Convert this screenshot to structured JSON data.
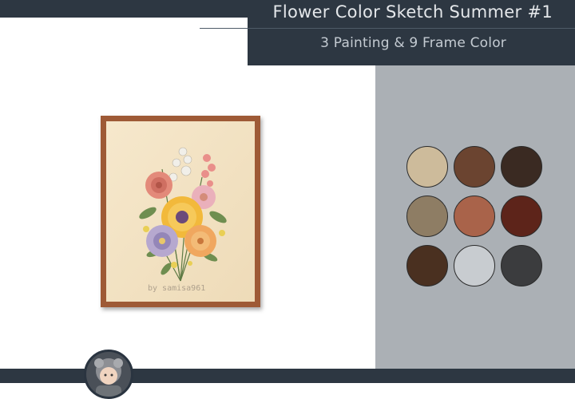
{
  "header": {
    "title": "Flower Color Sketch Summer #1",
    "subtitle": "3 Painting & 9 Frame Color"
  },
  "preview": {
    "watermark": "by samisa961",
    "frame_color": "#9e5a36",
    "canvas_color": "#f2e3c6"
  },
  "swatches": [
    {
      "color": "#cdbb9b"
    },
    {
      "color": "#6b4430"
    },
    {
      "color": "#3a2a22"
    },
    {
      "color": "#8e7d64"
    },
    {
      "color": "#a9634a"
    },
    {
      "color": "#5d241a"
    },
    {
      "color": "#4a3020"
    },
    {
      "color": "#c8ccd0"
    },
    {
      "color": "#3b3c3e"
    }
  ],
  "colors": {
    "header_bg": "#2d3742",
    "panel_bg": "#abb0b5",
    "page_bg": "#ffffff"
  },
  "icons": {
    "avatar": "creator-avatar-icon"
  }
}
